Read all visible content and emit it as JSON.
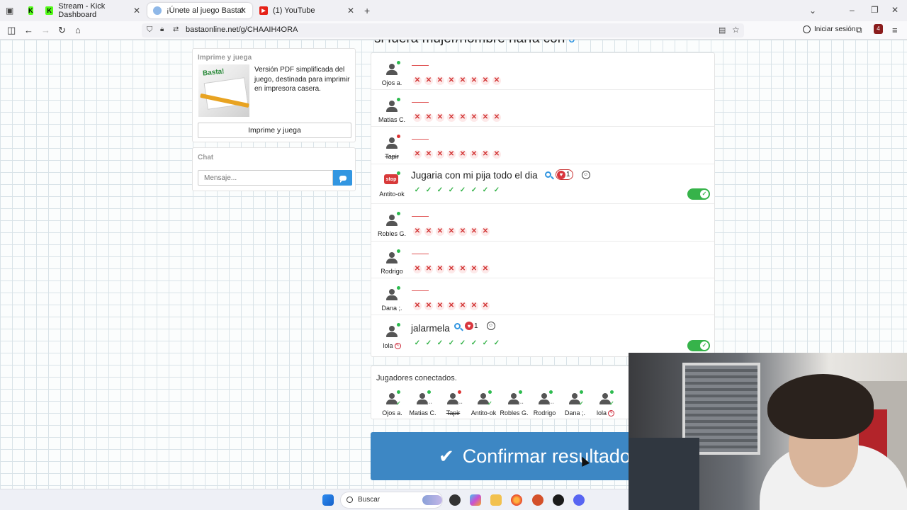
{
  "browser": {
    "tabs": [
      {
        "label": "",
        "icon": "kick-icon"
      },
      {
        "label": "Stream - Kick Dashboard",
        "icon": "kick-icon"
      },
      {
        "label": "¡Únete al juego Basta!",
        "icon": "basta-icon"
      },
      {
        "label": "(1) YouTube",
        "icon": "youtube-icon"
      }
    ],
    "url": "bastaonline.net/g/CHAAIH4ORA",
    "signin_label": "Iniciar sesión",
    "extension_badge": "4"
  },
  "left": {
    "print": {
      "title": "Imprime y juega",
      "description": "Versión PDF simplificada del juego, destinada para imprimir en impresora casera.",
      "thumb_logo": "Basta!",
      "button": "Imprime y juega"
    },
    "chat": {
      "title": "Chat",
      "placeholder": "Mensaje..."
    }
  },
  "category": {
    "heading": "si fuera mujer/hombre haría con",
    "letter": "J"
  },
  "answers": [
    {
      "player": "Ojos a.",
      "online": true,
      "answer": "",
      "marks": [
        "x",
        "x",
        "x",
        "x",
        "x",
        "x",
        "x",
        "x"
      ],
      "validated": false
    },
    {
      "player": "Matias C.",
      "online": true,
      "answer": "",
      "marks": [
        "x",
        "x",
        "x",
        "x",
        "x",
        "x",
        "x",
        "x"
      ],
      "validated": false
    },
    {
      "player": "Tapir",
      "online": false,
      "answer": "",
      "marks": [
        "x",
        "x",
        "x",
        "x",
        "x",
        "x",
        "x",
        "x"
      ],
      "validated": false
    },
    {
      "player": "Antito-ok",
      "online": true,
      "answer": "Jugaria con mi pija todo el dia",
      "likes": "1",
      "marks": [
        "ok",
        "ok",
        "ok",
        "ok",
        "ok",
        "ok",
        "ok",
        "ok"
      ],
      "validated": true
    },
    {
      "player": "Robles G.",
      "online": true,
      "answer": "",
      "marks": [
        "x",
        "x",
        "x",
        "x",
        "x",
        "x",
        "x"
      ],
      "validated": false
    },
    {
      "player": "Rodrigo",
      "online": true,
      "answer": "",
      "marks": [
        "x",
        "x",
        "x",
        "x",
        "x",
        "x",
        "x"
      ],
      "validated": false
    },
    {
      "player": "Dana ;.",
      "online": true,
      "answer": "",
      "marks": [
        "x",
        "x",
        "x",
        "x",
        "x",
        "x",
        "x"
      ],
      "validated": false
    },
    {
      "player": "lola",
      "online": true,
      "answer": "jalarmela",
      "likes": "1",
      "marks": [
        "ok",
        "ok",
        "ok",
        "ok",
        "ok",
        "ok",
        "ok",
        "ok"
      ],
      "validated": true
    }
  ],
  "connected": {
    "title": "Jugadores conectados.",
    "players": [
      {
        "name": "Ojos a.",
        "status": "ok"
      },
      {
        "name": "Matias C.",
        "status": "typing"
      },
      {
        "name": "Tapir",
        "status": "typing"
      },
      {
        "name": "Antito-ok",
        "status": "ok"
      },
      {
        "name": "Robles G.",
        "status": "typing"
      },
      {
        "name": "Rodrigo",
        "status": "typing"
      },
      {
        "name": "Dana ;.",
        "status": "ok"
      },
      {
        "name": "lola",
        "status": "ok"
      }
    ]
  },
  "confirm_label": "Confirmar resultados",
  "taskbar": {
    "search_label": "Buscar"
  },
  "colors": {
    "accent": "#3296e1",
    "confirm": "#3d87c4",
    "valid": "#36b34a",
    "invalid": "#d23535"
  }
}
